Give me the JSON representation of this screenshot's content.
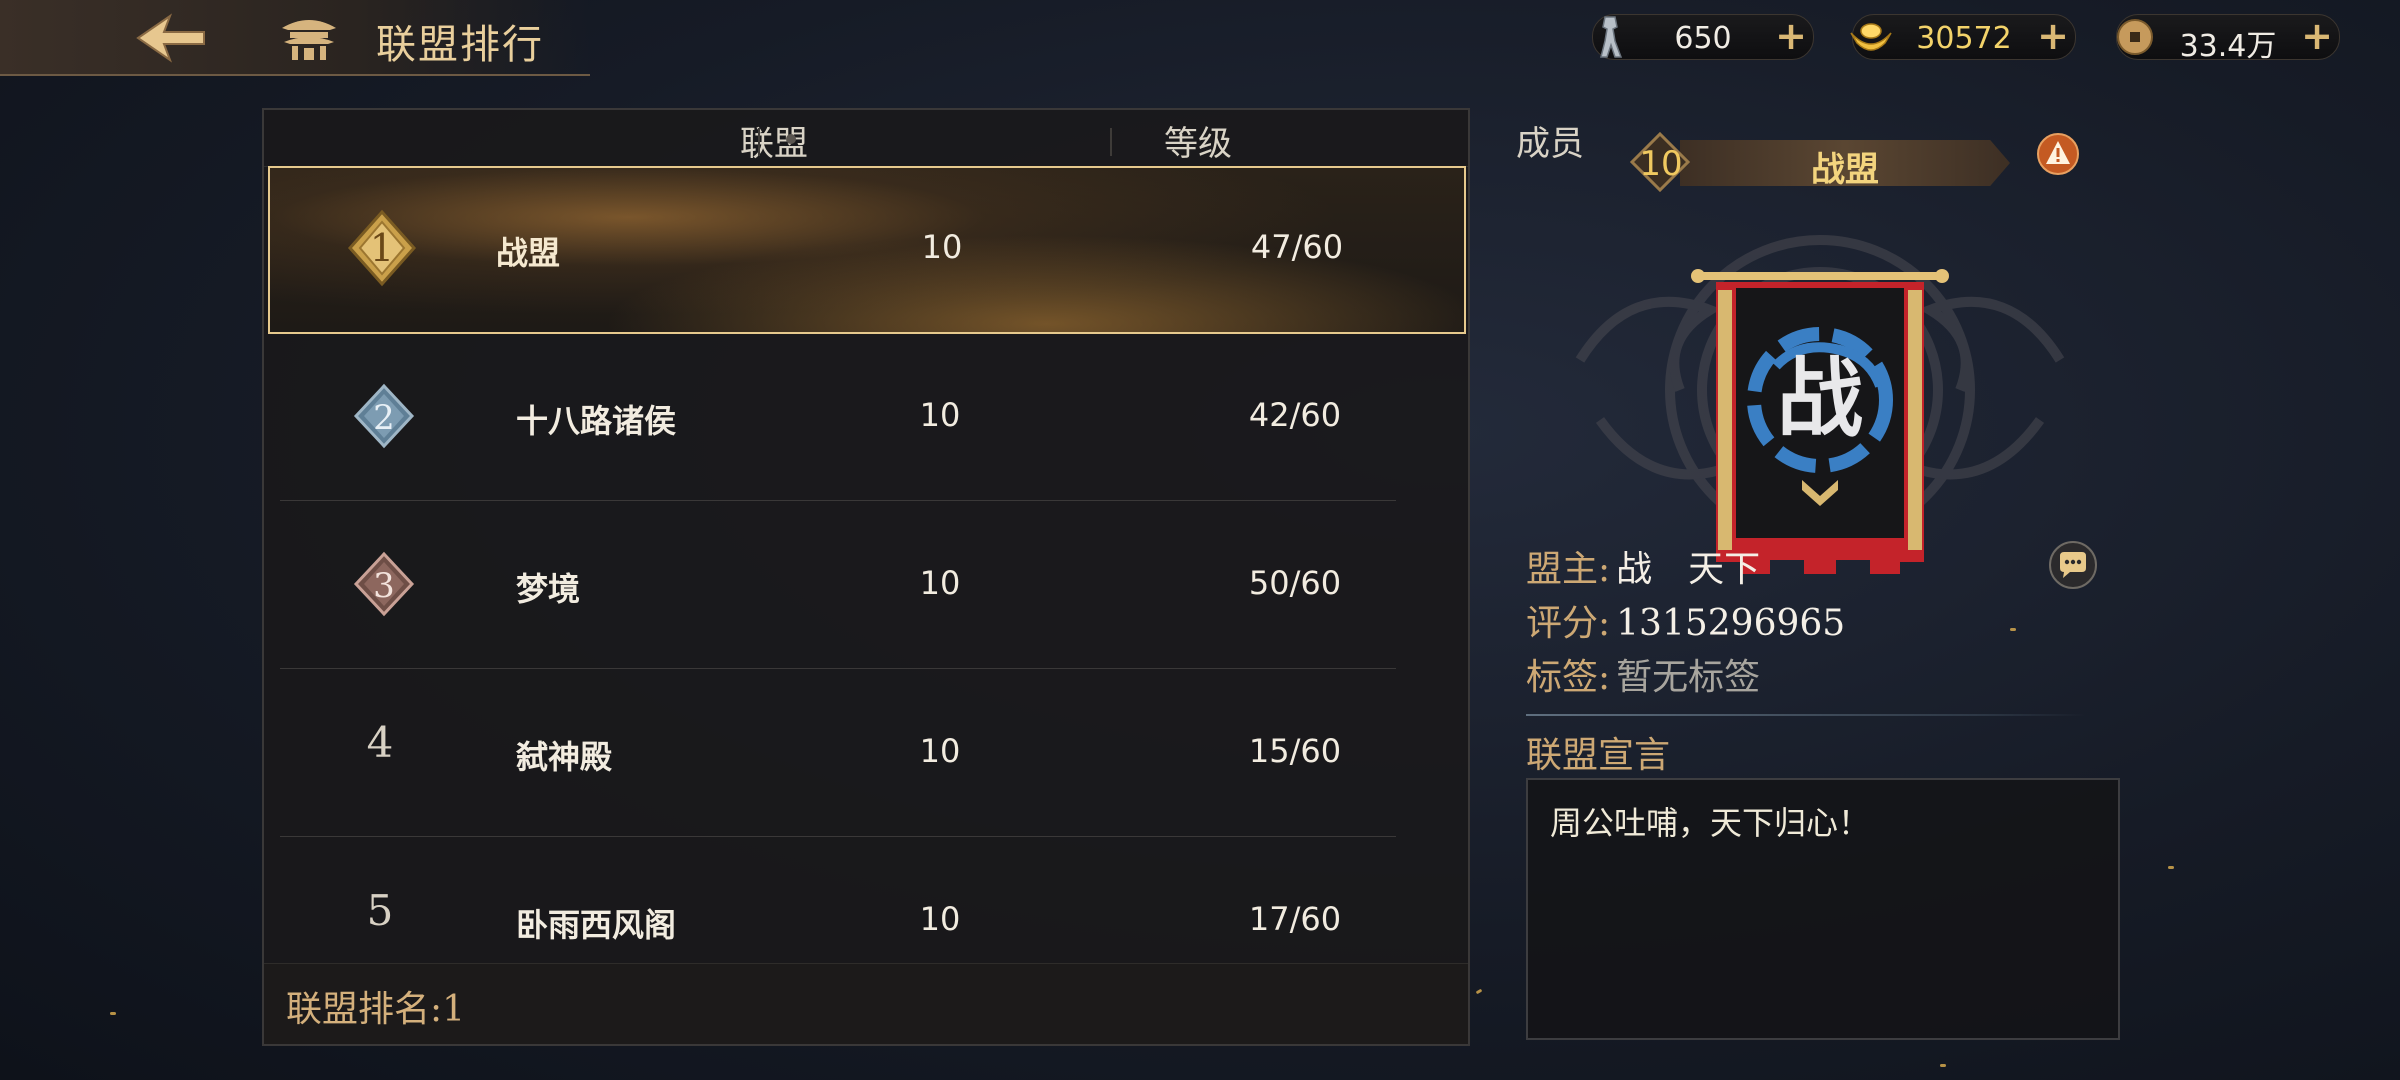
{
  "header": {
    "title": "联盟排行",
    "back_icon": "arrow-left-icon",
    "hall_icon": "pavilion-icon"
  },
  "resources": [
    {
      "name": "stamina",
      "icon": "soldier-icon",
      "value": "650"
    },
    {
      "name": "gold",
      "icon": "gold-ingot-icon",
      "value": "30572"
    },
    {
      "name": "copper",
      "icon": "coin-icon",
      "value": "33.4万"
    }
  ],
  "ranking": {
    "columns": [
      "联盟",
      "等级",
      "成员"
    ],
    "rows": [
      {
        "rank": "1",
        "name": "战盟",
        "level": "10",
        "members": "47/60"
      },
      {
        "rank": "2",
        "name": "十八路诸侯",
        "level": "10",
        "members": "42/60"
      },
      {
        "rank": "3",
        "name": "梦境",
        "level": "10",
        "members": "50/60"
      },
      {
        "rank": "4",
        "name": "弑神殿",
        "level": "10",
        "members": "15/60"
      },
      {
        "rank": "5",
        "name": "卧雨西风阁",
        "level": "10",
        "members": "17/60"
      }
    ],
    "footer": "联盟排名:1"
  },
  "detail": {
    "level": "10",
    "name": "战盟",
    "emblem_char": "战",
    "leader_label": "盟主:",
    "leader_value": "战　天下",
    "score_label": "评分:",
    "score_value": "1315296965",
    "tags_label": "标签:",
    "tags_value": "暂无标签",
    "declaration_title": "联盟宣言",
    "declaration": "周公吐哺，天下归心！"
  },
  "colors": {
    "accent_gold": "#e6c98d",
    "banner_red": "#c4232a",
    "dragon_blue": "#3a7fc4"
  }
}
